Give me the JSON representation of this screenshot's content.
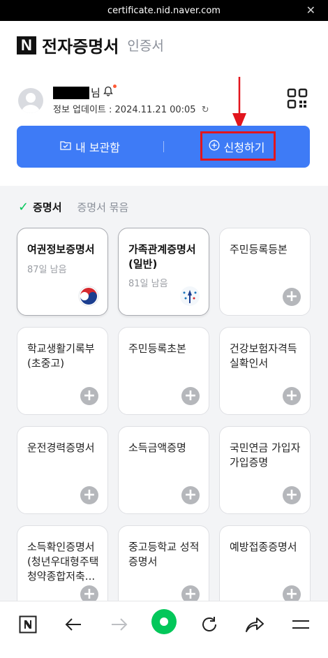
{
  "browser": {
    "url": "certificate.nid.naver.com"
  },
  "header": {
    "logo": "N",
    "title": "전자증명서",
    "subtitle": "인증서"
  },
  "profile": {
    "name_suffix": "님",
    "update_text": "정보 업데이트 : 2024.11.21 00:05"
  },
  "actions": {
    "my_storage": "내 보관함",
    "apply": "신청하기",
    "accent": "#3e7bf6",
    "highlight": "#e2151d"
  },
  "tabs": {
    "active": "증명서",
    "inactive": "증명서 묶음"
  },
  "cards": [
    {
      "title": "여권정보증명서",
      "days": "87일 남음",
      "issued": true,
      "emblem": "taegeuk-icon"
    },
    {
      "title": "가족관계증명서(일반)",
      "days": "81일 남음",
      "issued": true,
      "emblem": "court-icon"
    },
    {
      "title": "주민등록등본",
      "issued": false
    },
    {
      "title": "학교생활기록부(초중고)",
      "issued": false
    },
    {
      "title": "주민등록초본",
      "issued": false
    },
    {
      "title": "건강보험자격득실확인서",
      "issued": false
    },
    {
      "title": "운전경력증명서",
      "issued": false
    },
    {
      "title": "소득금액증명",
      "issued": false
    },
    {
      "title": "국민연금 가입자 가입증명",
      "issued": false
    },
    {
      "title": "소득확인증명서(청년우대형주택청약종합저축...",
      "issued": false
    },
    {
      "title": "중고등학교 성적증명서",
      "issued": false
    },
    {
      "title": "예방접종증명서",
      "issued": false
    }
  ],
  "navbar": {
    "items": [
      "naver-home-icon",
      "back-arrow-icon",
      "forward-arrow-icon",
      "green-dot-icon",
      "refresh-icon",
      "share-icon",
      "menu-icon"
    ],
    "green": "#03c75a"
  }
}
